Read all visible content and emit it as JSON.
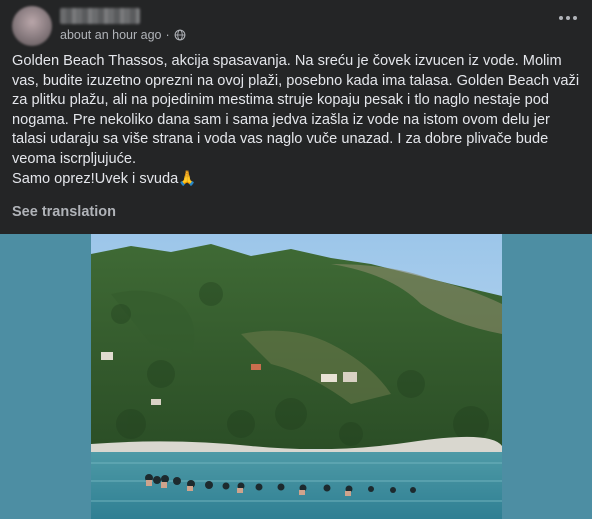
{
  "post": {
    "timestamp": "about an hour ago",
    "privacy_icon": "globe-icon",
    "menu_icon": "more-options-icon",
    "paragraphs": [
      "Golden Beach Thassos, akcija spasavanja. Na sreću je čovek izvucen iz vode. Molim vas, budite izuzetno oprezni na ovoj plaži, posebno kada ima talasa. Golden Beach važi za plitku plažu, ali na pojedinim mestima struje kopaju pesak i tlo naglo nestaje pod nogama. Pre nekoliko dana sam i sama jedva izašla iz vode na istom ovom delu jer talasi udaraju sa više strana i voda vas naglo vuče unazad. I za dobre plivače bude veoma iscrpljujuće.",
      "Samo oprez!Uvek i svuda🙏"
    ],
    "see_translation": "See translation"
  },
  "colors": {
    "background": "#242526",
    "primary_text": "#e4e6eb",
    "secondary_text": "#b0b3b8",
    "media_backdrop": "#4d8ea3"
  }
}
